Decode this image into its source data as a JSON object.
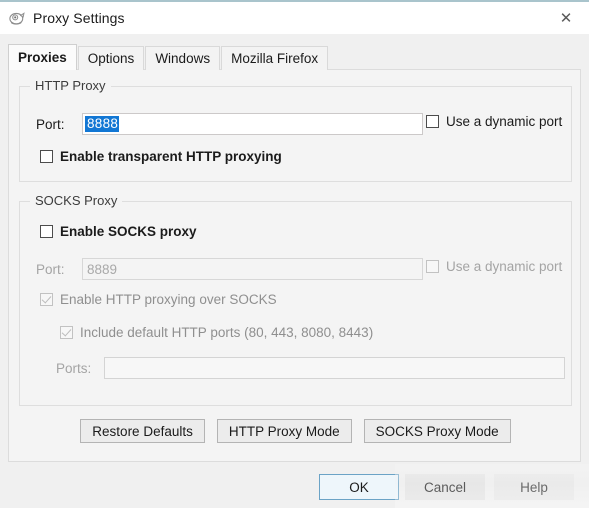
{
  "window": {
    "title": "Proxy Settings",
    "icon": "fiddler-app-icon",
    "close_label": "✕"
  },
  "tabs": [
    {
      "label": "Proxies",
      "active": true
    },
    {
      "label": "Options",
      "active": false
    },
    {
      "label": "Windows",
      "active": false
    },
    {
      "label": "Mozilla Firefox",
      "active": false
    }
  ],
  "http_proxy": {
    "group_title": "HTTP Proxy",
    "port_label": "Port:",
    "port_value": "8888",
    "dynamic_port_label": "Use a dynamic port",
    "dynamic_port_checked": false,
    "transparent_label": "Enable transparent HTTP proxying",
    "transparent_checked": false
  },
  "socks_proxy": {
    "group_title": "SOCKS Proxy",
    "enable_label": "Enable SOCKS proxy",
    "enable_checked": false,
    "port_label": "Port:",
    "port_value": "8889",
    "port_disabled": true,
    "dynamic_port_label": "Use a dynamic port",
    "dynamic_port_checked": false,
    "dynamic_port_disabled": true,
    "http_over_socks_label": "Enable HTTP proxying over SOCKS",
    "http_over_socks_checked": true,
    "http_over_socks_disabled": true,
    "include_default_label": "Include default HTTP ports (80, 443, 8080, 8443)",
    "include_default_checked": true,
    "include_default_disabled": true,
    "ports_label": "Ports:",
    "ports_value": "",
    "ports_disabled": true
  },
  "mode_buttons": [
    {
      "label": "Restore Defaults"
    },
    {
      "label": "HTTP Proxy Mode"
    },
    {
      "label": "SOCKS Proxy Mode"
    }
  ],
  "footer": {
    "ok_label": "OK",
    "cancel_label": "Cancel",
    "help_label": "Help"
  },
  "colors": {
    "selection_blue": "#1277d4",
    "focus_border": "#6ba3c6",
    "dialog_bg": "#f0f0f0",
    "panel_bg": "#f4f4f4"
  }
}
